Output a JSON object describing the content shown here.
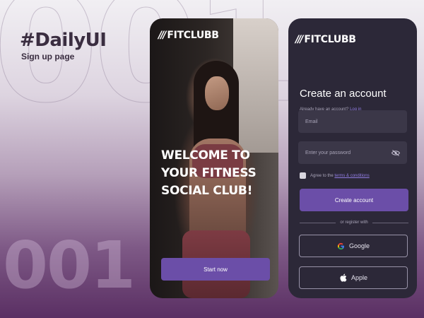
{
  "header": {
    "bg_outline_text": "001",
    "title": "#DailyUI",
    "subtitle": "Sign up page",
    "big_number": "001"
  },
  "brand": {
    "mark": "///",
    "name": "FITCLUBB"
  },
  "welcome_screen": {
    "headline": "WELCOME TO YOUR FITNESS SOCIAL CLUB!",
    "start_button": "Start now"
  },
  "signup_screen": {
    "title": "Create an account",
    "have_account_text": "Already have an account?",
    "login_link": "Log in",
    "email_placeholder": "Email",
    "password_placeholder": "Enter your password",
    "agree_text": "Agree to the",
    "terms_link": "terms & conditions",
    "create_button": "Create account",
    "divider_text": "or register with",
    "google_button": "Google",
    "apple_button": "Apple"
  },
  "colors": {
    "accent": "#6b4ea8",
    "link": "#8f7be0",
    "panel": "#2c2838"
  },
  "icons": [
    "fitclubb-logo-icon",
    "eye-off-icon",
    "google-icon",
    "apple-icon"
  ]
}
